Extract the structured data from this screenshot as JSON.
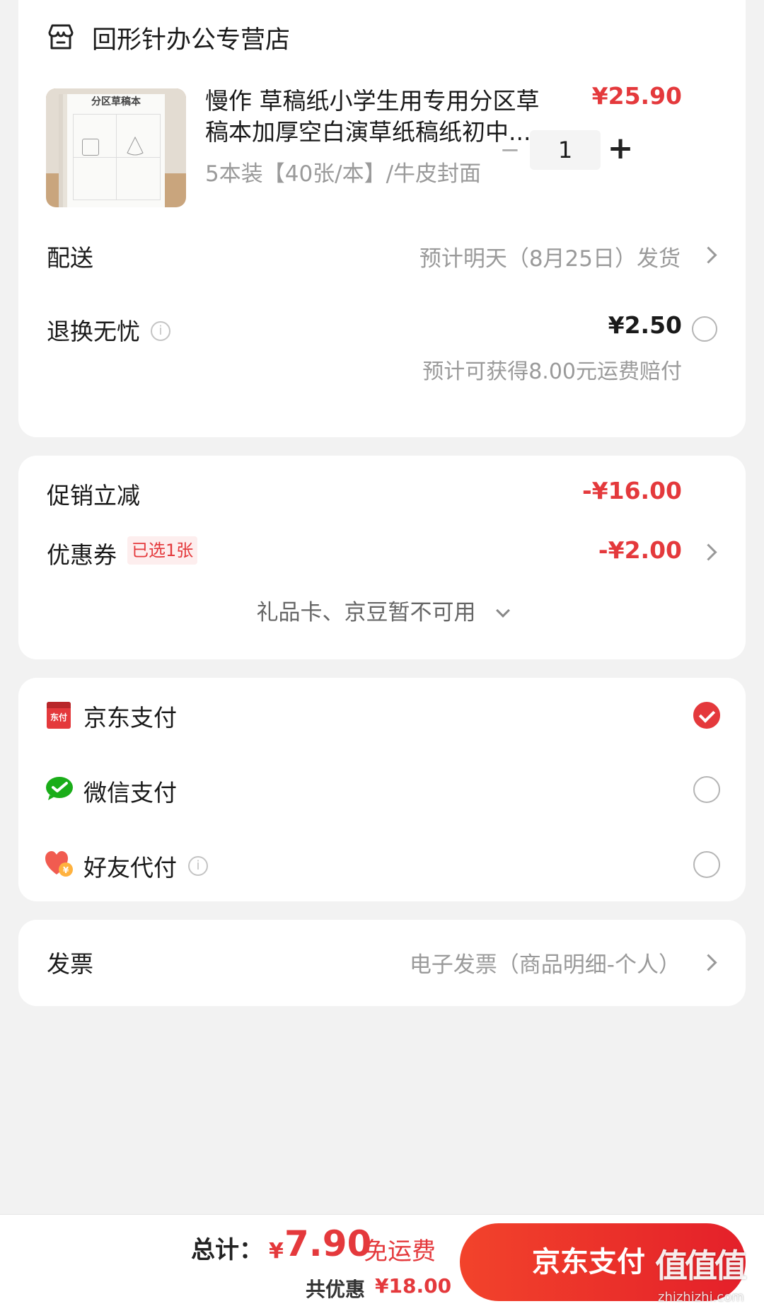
{
  "shop": {
    "name": "回形针办公专营店",
    "icon": "store-icon"
  },
  "product": {
    "thumb_label": "分区草稿本",
    "title_line1": "慢作 草稿纸小学生用专用分区草",
    "title_line2": "稿本加厚空白演草纸稿纸初中...",
    "spec": "5本装【40张/本】/牛皮封面",
    "price": "¥25.90",
    "quantity": "1",
    "minus": "−",
    "plus": "+"
  },
  "delivery": {
    "label": "配送",
    "value": "预计明天（8月25日）发货"
  },
  "return_service": {
    "label": "退换无忧",
    "price": "¥2.50",
    "note": "预计可获得8.00元运费赔付",
    "checked": false
  },
  "promo": {
    "discount_label": "促销立减",
    "discount_value": "-¥16.00",
    "coupon_label": "优惠券",
    "coupon_badge": "已选1张",
    "coupon_value": "-¥2.00",
    "unavailable": "礼品卡、京豆暂不可用"
  },
  "payment": {
    "options": [
      {
        "label": "京东支付",
        "icon": "jd-pay-icon",
        "icon_text": "东付",
        "checked": true
      },
      {
        "label": "微信支付",
        "icon": "wechat-pay-icon",
        "checked": false
      },
      {
        "label": "好友代付",
        "icon": "friend-pay-icon",
        "checked": false
      }
    ]
  },
  "invoice": {
    "label": "发票",
    "value": "电子发票（商品明细-个人）"
  },
  "footer": {
    "total_label": "总计：",
    "currency": "¥",
    "total": "7.90",
    "free_shipping": "免运费",
    "saved_label": "共优惠",
    "saved_value": "¥18.00",
    "submit": "京东支付"
  },
  "watermark": {
    "text": "值值值",
    "url": "zhizhizhi.com"
  },
  "colors": {
    "accent": "#e4393c",
    "background": "#f2f2f2",
    "card": "#ffffff"
  }
}
